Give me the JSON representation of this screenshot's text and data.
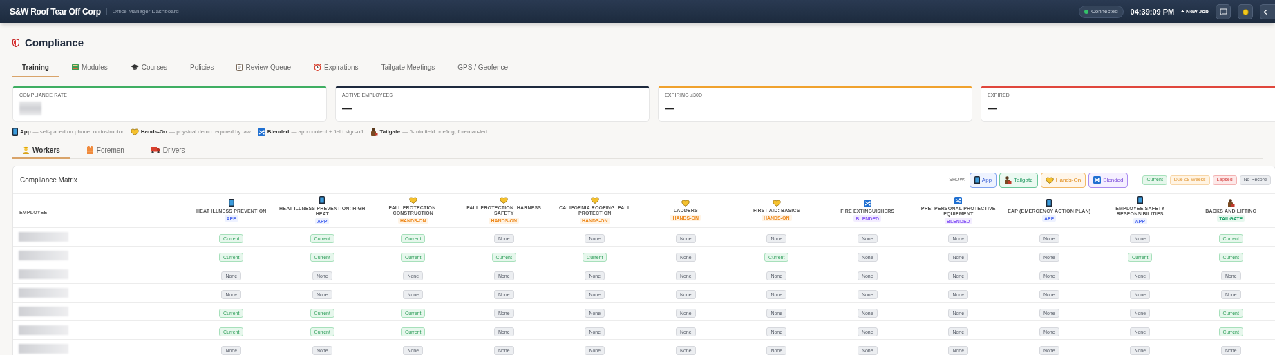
{
  "header": {
    "brand": "S&W Roof Tear Off Corp",
    "subtitle": "Office Manager Dashboard",
    "connection": {
      "label": "Connected",
      "connected": true
    },
    "time": "04:39:09 PM",
    "new_job": "+ New Job"
  },
  "page": {
    "title": "Compliance",
    "tabs": [
      {
        "label": "Training",
        "selected": true
      },
      {
        "label": "Modules",
        "selected": false
      },
      {
        "label": "Courses",
        "selected": false
      },
      {
        "label": "Policies",
        "selected": false
      },
      {
        "label": "Review Queue",
        "selected": false
      },
      {
        "label": "Expirations",
        "selected": false
      },
      {
        "label": "Tailgate Meetings",
        "selected": false
      },
      {
        "label": "GPS / Geofence",
        "selected": false
      }
    ],
    "stats": [
      {
        "label": "COMPLIANCE RATE",
        "color": "#3fae62"
      },
      {
        "label": "ACTIVE EMPLOYEES",
        "value": "—",
        "color": "#1e2a3e"
      },
      {
        "label": "EXPIRING ≤30D",
        "value": "—",
        "color": "#f0a22e"
      },
      {
        "label": "EXPIRED",
        "value": "—",
        "color": "#e0473c"
      }
    ],
    "legend": [
      {
        "kind": "app",
        "label": "App",
        "description": "— self-paced on phone, no instructor"
      },
      {
        "kind": "hands_on",
        "label": "Hands-On",
        "description": "— physical demo required by law"
      },
      {
        "kind": "blended",
        "label": "Blended",
        "description": "— app content + field sign-off"
      },
      {
        "kind": "tailgate",
        "label": "Tailgate",
        "description": "— 5-min field briefing, foreman-led"
      }
    ],
    "subtabs": [
      {
        "label": "Workers",
        "selected": true
      },
      {
        "label": "Foremen",
        "selected": false
      },
      {
        "label": "Drivers",
        "selected": false
      }
    ],
    "matrix": {
      "title": "Compliance Matrix",
      "filter_label": "SHOW:",
      "filters": [
        {
          "kind": "app",
          "label": "App"
        },
        {
          "kind": "tailgate",
          "label": "Tailgate"
        },
        {
          "kind": "hands_on",
          "label": "Hands-On"
        },
        {
          "kind": "blended",
          "label": "Blended"
        }
      ],
      "status_legend": [
        {
          "kind": "current",
          "label": "Current"
        },
        {
          "kind": "due",
          "label": "Due ≤8 Weeks"
        },
        {
          "kind": "lapsed",
          "label": "Lapsed"
        },
        {
          "kind": "none",
          "label": "No Record"
        }
      ],
      "employee_heading": "EMPLOYEE",
      "columns": [
        {
          "label": "HEAT ILLNESS PREVENTION",
          "kind": "app",
          "tag": "APP"
        },
        {
          "label": "HEAT ILLNESS PREVENTION: HIGH HEAT",
          "kind": "app",
          "tag": "APP"
        },
        {
          "label": "FALL PROTECTION: CONSTRUCTION",
          "kind": "hands_on",
          "tag": "HANDS-ON"
        },
        {
          "label": "FALL PROTECTION: HARNESS SAFETY",
          "kind": "hands_on",
          "tag": "HANDS-ON"
        },
        {
          "label": "CALIFORNIA ROOFING: FALL PROTECTION",
          "kind": "hands_on",
          "tag": "HANDS-ON"
        },
        {
          "label": "LADDERS",
          "kind": "hands_on",
          "tag": "HANDS-ON"
        },
        {
          "label": "FIRST AID: BASICS",
          "kind": "hands_on",
          "tag": "HANDS-ON"
        },
        {
          "label": "FIRE EXTINGUISHERS",
          "kind": "blended",
          "tag": "BLENDED"
        },
        {
          "label": "PPE: PERSONAL PROTECTIVE EQUIPMENT",
          "kind": "blended",
          "tag": "BLENDED"
        },
        {
          "label": "EAP (EMERGENCY ACTION PLAN)",
          "kind": "app",
          "tag": "APP"
        },
        {
          "label": "EMPLOYEE SAFETY RESPONSIBILITIES",
          "kind": "app",
          "tag": "APP"
        },
        {
          "label": "BACKS AND LIFTING",
          "kind": "tailgate",
          "tag": "TAILGATE"
        }
      ],
      "rows": [
        {
          "cells": [
            {
              "kind": "current",
              "label": "Current"
            },
            {
              "kind": "current",
              "label": "Current"
            },
            {
              "kind": "current",
              "label": "Current"
            },
            {
              "kind": "none",
              "label": "None"
            },
            {
              "kind": "none",
              "label": "None"
            },
            {
              "kind": "none",
              "label": "None"
            },
            {
              "kind": "none",
              "label": "None"
            },
            {
              "kind": "none",
              "label": "None"
            },
            {
              "kind": "none",
              "label": "None"
            },
            {
              "kind": "none",
              "label": "None"
            },
            {
              "kind": "none",
              "label": "None"
            },
            {
              "kind": "current",
              "label": "Current"
            }
          ]
        },
        {
          "cells": [
            {
              "kind": "current",
              "label": "Current"
            },
            {
              "kind": "current",
              "label": "Current"
            },
            {
              "kind": "current",
              "label": "Current"
            },
            {
              "kind": "current",
              "label": "Current"
            },
            {
              "kind": "current",
              "label": "Current"
            },
            {
              "kind": "none",
              "label": "None"
            },
            {
              "kind": "current",
              "label": "Current"
            },
            {
              "kind": "none",
              "label": "None"
            },
            {
              "kind": "none",
              "label": "None"
            },
            {
              "kind": "none",
              "label": "None"
            },
            {
              "kind": "current",
              "label": "Current"
            },
            {
              "kind": "current",
              "label": "Current"
            }
          ]
        },
        {
          "cells": [
            {
              "kind": "none",
              "label": "None"
            },
            {
              "kind": "none",
              "label": "None"
            },
            {
              "kind": "none",
              "label": "None"
            },
            {
              "kind": "none",
              "label": "None"
            },
            {
              "kind": "none",
              "label": "None"
            },
            {
              "kind": "none",
              "label": "None"
            },
            {
              "kind": "none",
              "label": "None"
            },
            {
              "kind": "none",
              "label": "None"
            },
            {
              "kind": "none",
              "label": "None"
            },
            {
              "kind": "none",
              "label": "None"
            },
            {
              "kind": "none",
              "label": "None"
            },
            {
              "kind": "none",
              "label": "None"
            }
          ]
        },
        {
          "cells": [
            {
              "kind": "none",
              "label": "None"
            },
            {
              "kind": "none",
              "label": "None"
            },
            {
              "kind": "none",
              "label": "None"
            },
            {
              "kind": "none",
              "label": "None"
            },
            {
              "kind": "none",
              "label": "None"
            },
            {
              "kind": "none",
              "label": "None"
            },
            {
              "kind": "none",
              "label": "None"
            },
            {
              "kind": "none",
              "label": "None"
            },
            {
              "kind": "none",
              "label": "None"
            },
            {
              "kind": "none",
              "label": "None"
            },
            {
              "kind": "none",
              "label": "None"
            },
            {
              "kind": "none",
              "label": "None"
            }
          ]
        },
        {
          "cells": [
            {
              "kind": "current",
              "label": "Current"
            },
            {
              "kind": "current",
              "label": "Current"
            },
            {
              "kind": "current",
              "label": "Current"
            },
            {
              "kind": "none",
              "label": "None"
            },
            {
              "kind": "none",
              "label": "None"
            },
            {
              "kind": "none",
              "label": "None"
            },
            {
              "kind": "none",
              "label": "None"
            },
            {
              "kind": "none",
              "label": "None"
            },
            {
              "kind": "none",
              "label": "None"
            },
            {
              "kind": "none",
              "label": "None"
            },
            {
              "kind": "none",
              "label": "None"
            },
            {
              "kind": "current",
              "label": "Current"
            }
          ]
        },
        {
          "cells": [
            {
              "kind": "current",
              "label": "Current"
            },
            {
              "kind": "current",
              "label": "Current"
            },
            {
              "kind": "current",
              "label": "Current"
            },
            {
              "kind": "none",
              "label": "None"
            },
            {
              "kind": "none",
              "label": "None"
            },
            {
              "kind": "none",
              "label": "None"
            },
            {
              "kind": "none",
              "label": "None"
            },
            {
              "kind": "none",
              "label": "None"
            },
            {
              "kind": "none",
              "label": "None"
            },
            {
              "kind": "none",
              "label": "None"
            },
            {
              "kind": "none",
              "label": "None"
            },
            {
              "kind": "current",
              "label": "Current"
            }
          ]
        },
        {
          "cells": [
            {
              "kind": "none",
              "label": "None"
            },
            {
              "kind": "none",
              "label": "None"
            },
            {
              "kind": "none",
              "label": "None"
            },
            {
              "kind": "none",
              "label": "None"
            },
            {
              "kind": "none",
              "label": "None"
            },
            {
              "kind": "none",
              "label": "None"
            },
            {
              "kind": "none",
              "label": "None"
            },
            {
              "kind": "none",
              "label": "None"
            },
            {
              "kind": "none",
              "label": "None"
            },
            {
              "kind": "none",
              "label": "None"
            },
            {
              "kind": "none",
              "label": "None"
            },
            {
              "kind": "none",
              "label": "None"
            }
          ]
        }
      ]
    }
  }
}
